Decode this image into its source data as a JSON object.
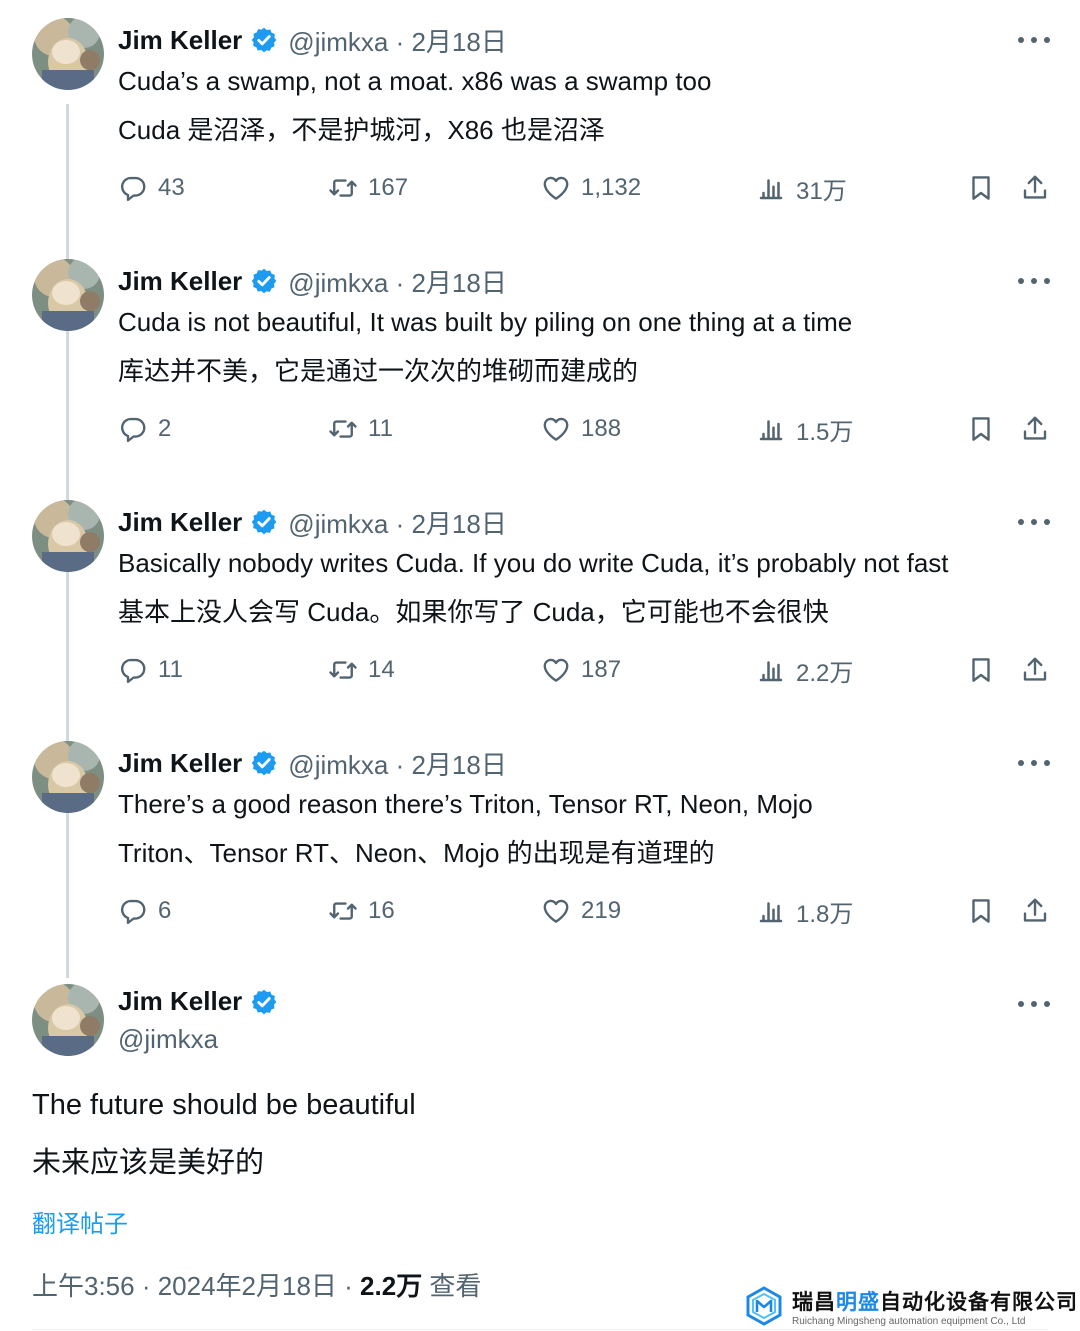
{
  "colors": {
    "accent": "#1d9bf0",
    "text": "#0f1419",
    "muted": "#536471",
    "thread_line": "#cfd9de"
  },
  "author": {
    "name": "Jim Keller",
    "handle": "@jimkxa",
    "verified_icon": "verified-badge-icon"
  },
  "tweets": [
    {
      "meta": "@jimkxa · 2月18日",
      "text_en": "Cuda’s a swamp, not a moat. x86 was a swamp too",
      "text_cn": "Cuda 是沼泽，不是护城河，X86 也是沼泽",
      "replies": "43",
      "retweets": "167",
      "likes": "1,132",
      "views": "31万"
    },
    {
      "meta": "@jimkxa · 2月18日",
      "text_en": "Cuda is not beautiful, It was built by piling on one thing at a time",
      "text_cn": "库达并不美，它是通过一次次的堆砌而建成的",
      "replies": "2",
      "retweets": "11",
      "likes": "188",
      "views": "1.5万"
    },
    {
      "meta": "@jimkxa · 2月18日",
      "text_en": "Basically nobody writes Cuda. If you do write Cuda, it’s probably not fast",
      "text_cn": "基本上没人会写 Cuda。如果你写了 Cuda，它可能也不会很快",
      "replies": "11",
      "retweets": "14",
      "likes": "187",
      "views": "2.2万"
    },
    {
      "meta": "@jimkxa · 2月18日",
      "text_en": "There’s a good reason there’s Triton, Tensor RT, Neon, Mojo",
      "text_cn": "Triton、Tensor RT、Neon、Mojo 的出现是有道理的",
      "replies": "6",
      "retweets": "16",
      "likes": "219",
      "views": "1.8万"
    }
  ],
  "main": {
    "text_en": "The future should be beautiful",
    "text_cn": "未来应该是美好的",
    "translate_label": "翻译帖子",
    "timestamp": "上午3:56 · 2024年2月18日 · ",
    "views_count": "2.2万",
    "views_label": " 查看"
  },
  "watermark": {
    "cn_prefix": "瑞昌",
    "cn_highlight": "明盛",
    "cn_suffix": "自动化设备有限公司",
    "en": "Ruichang Mingsheng automation equipment Co., Ltd"
  }
}
